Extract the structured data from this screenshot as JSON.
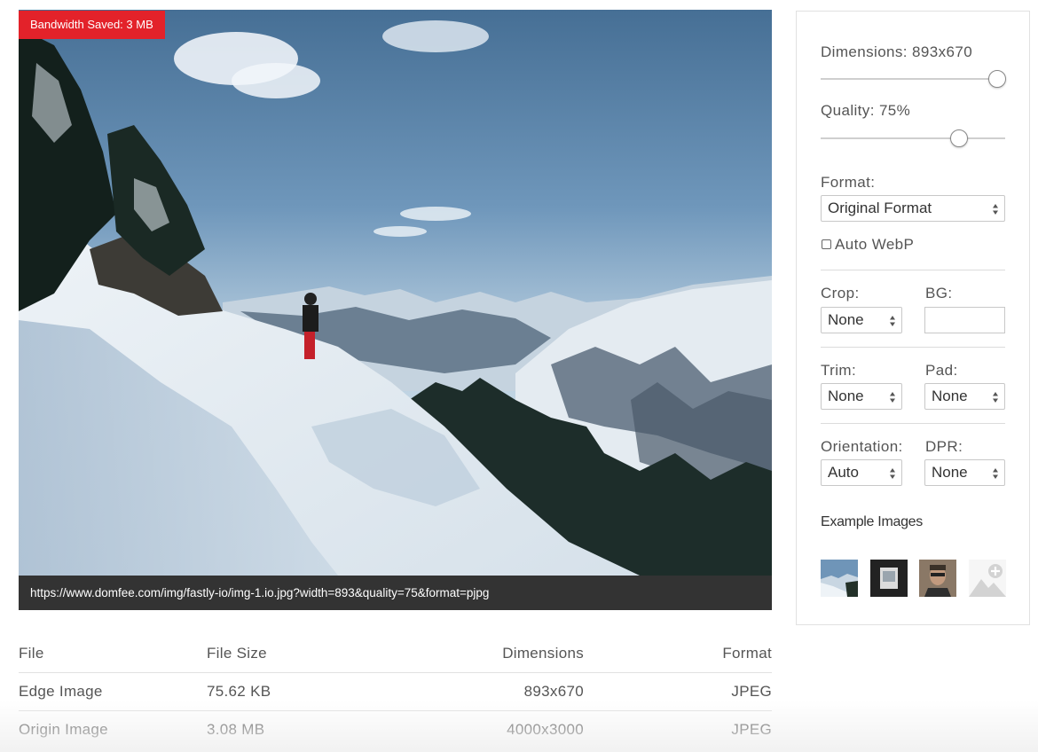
{
  "preview": {
    "badge": "Bandwidth Saved: 3 MB",
    "url": "https://www.domfee.com/img/fastly-io/img-1.io.jpg?width=893&quality=75&format=pjpg"
  },
  "info_table": {
    "headers": [
      "File",
      "File Size",
      "Dimensions",
      "Format"
    ],
    "rows": [
      [
        "Edge Image",
        "75.62 KB",
        "893x670",
        "JPEG"
      ],
      [
        "Origin Image",
        "3.08 MB",
        "4000x3000",
        "JPEG"
      ]
    ]
  },
  "settings": {
    "dimensions_label": "Dimensions: 893x670",
    "dimensions_slider_fraction": 1.0,
    "quality_label": "Quality: 75%",
    "quality_slider_fraction": 0.75,
    "format_label": "Format:",
    "format_value": "Original Format",
    "auto_webp_label": "Auto WebP",
    "auto_webp_checked": false,
    "crop_label": "Crop:",
    "crop_value": "None",
    "bg_label": "BG:",
    "bg_value": "",
    "trim_label": "Trim:",
    "trim_value": "None",
    "pad_label": "Pad:",
    "pad_value": "None",
    "orientation_label": "Orientation:",
    "orientation_value": "Auto",
    "dpr_label": "DPR:",
    "dpr_value": "None",
    "examples_title": "Example Images",
    "example_thumbnails": [
      "mountain-thumb",
      "document-thumb",
      "portrait-thumb",
      "add-image-icon"
    ]
  },
  "colors": {
    "badge_bg": "#e3222a",
    "url_bar_bg": "#333333",
    "border": "#e1e1e1"
  }
}
